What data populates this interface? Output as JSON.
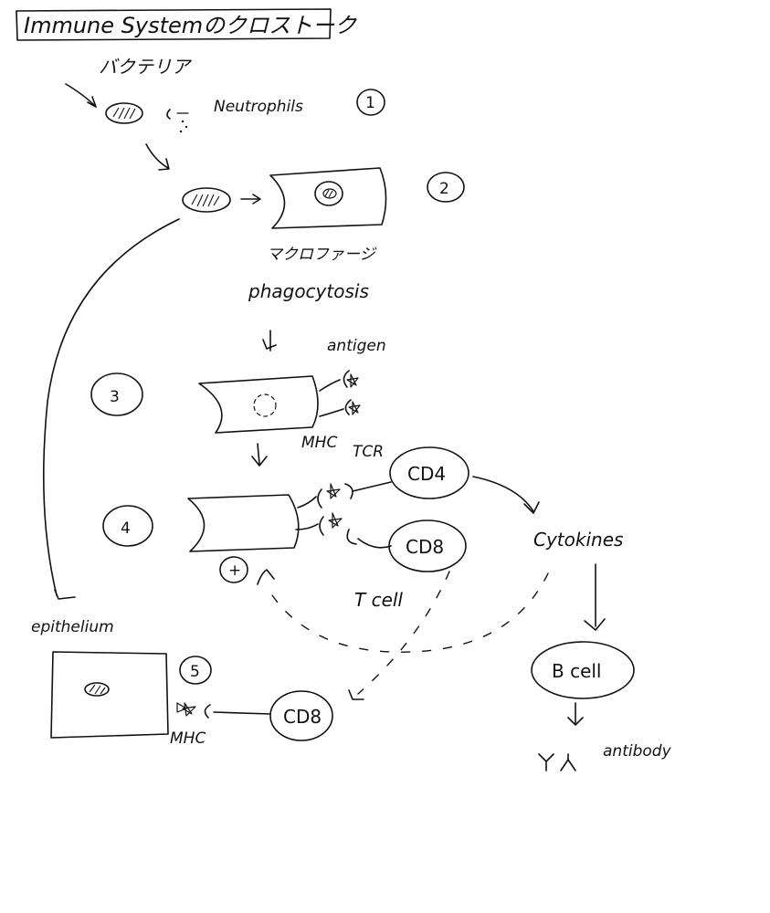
{
  "title": "Immune Systemのクロストーク",
  "steps": [
    "1",
    "2",
    "3",
    "4",
    "5"
  ],
  "labels": {
    "bacteria": "バクテリア",
    "neutrophils": "Neutrophils",
    "macrophage": "マクロファージ",
    "phagocytosis": "phagocytosis",
    "antigen": "antigen",
    "mhc_step3": "MHC",
    "tcr": "TCR",
    "cd4": "CD4",
    "cd8": "CD8",
    "t_cell": "T cell",
    "plus": "+",
    "cytokines": "Cytokines",
    "b_cell": "B cell",
    "antibody": "antibody",
    "epithelium": "epithelium",
    "mhc_step5": "MHC",
    "cd8_step5": "CD8"
  },
  "colors": {
    "ink": "#111111",
    "background": "#ffffff"
  }
}
